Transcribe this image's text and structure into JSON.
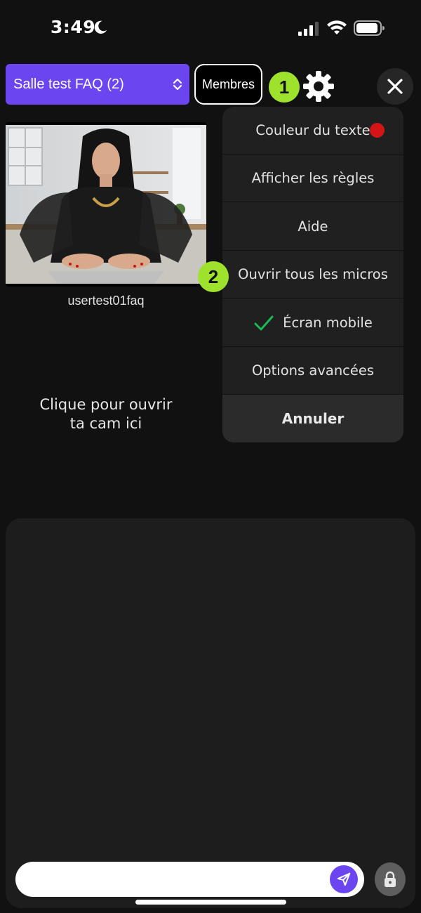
{
  "status_bar": {
    "time": "3:49"
  },
  "header": {
    "room_name": "Salle test FAQ (2)",
    "members_label": "Membres"
  },
  "annotations": {
    "step_1": "1",
    "step_2": "2"
  },
  "video": {
    "username": "usertest01faq"
  },
  "open_cam_prompt": {
    "line1": "Clique pour ouvrir",
    "line2": "ta cam ici"
  },
  "settings_menu": {
    "items": [
      {
        "label": "Couleur du texte",
        "accessory": "red-dot",
        "accessory_color": "#d41515"
      },
      {
        "label": "Afficher les règles"
      },
      {
        "label": "Aide"
      },
      {
        "label": "Ouvrir tous les micros"
      },
      {
        "label": "Écran mobile",
        "checked": true,
        "accessory": "check-icon"
      },
      {
        "label": "Options avancées"
      }
    ],
    "cancel_label": "Annuler"
  },
  "chat": {
    "input_value": "",
    "input_placeholder": ""
  },
  "colors": {
    "accent": "#6b45f0",
    "annotation_badge": "#9ee22e",
    "check": "#1db954",
    "text_color_dot": "#d41515"
  },
  "icons": {
    "status": [
      "moon-icon",
      "signal-icon",
      "wifi-icon",
      "battery-icon"
    ],
    "header": [
      "updown-icon",
      "gear-icon",
      "close-icon"
    ],
    "chat": [
      "send-icon",
      "lock-icon"
    ]
  }
}
